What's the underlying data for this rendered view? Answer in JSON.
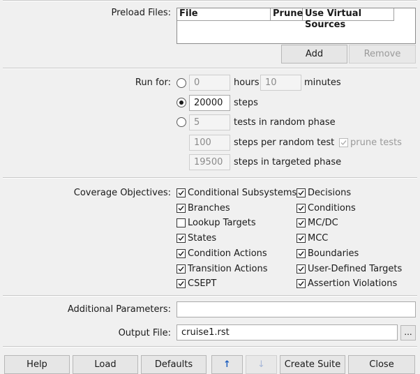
{
  "preload": {
    "label": "Preload Files:",
    "columns": [
      "File",
      "Prune",
      "Use Virtual Sources"
    ],
    "add_label": "Add",
    "remove_label": "Remove"
  },
  "run_for": {
    "label": "Run for:",
    "hours_value": "0",
    "hours_label": "hours",
    "minutes_value": "10",
    "minutes_label": "minutes",
    "steps_value": "20000",
    "steps_label": "steps",
    "tests_value": "5",
    "tests_label": "tests in random phase",
    "steps_per_random_value": "100",
    "steps_per_random_label": "steps per random test",
    "prune_tests_label": "prune tests",
    "steps_targeted_value": "19500",
    "steps_targeted_label": "steps in targeted phase",
    "selected": "steps"
  },
  "coverage": {
    "label": "Coverage Objectives:",
    "left": [
      {
        "label": "Conditional Subsystems",
        "checked": true
      },
      {
        "label": "Branches",
        "checked": true
      },
      {
        "label": "Lookup Targets",
        "checked": false
      },
      {
        "label": "States",
        "checked": true
      },
      {
        "label": "Condition Actions",
        "checked": true
      },
      {
        "label": "Transition Actions",
        "checked": true
      },
      {
        "label": "CSEPT",
        "checked": true
      }
    ],
    "right": [
      {
        "label": "Decisions",
        "checked": true
      },
      {
        "label": "Conditions",
        "checked": true
      },
      {
        "label": "MC/DC",
        "checked": true
      },
      {
        "label": "MCC",
        "checked": true
      },
      {
        "label": "Boundaries",
        "checked": true
      },
      {
        "label": "User-Defined Targets",
        "checked": true
      },
      {
        "label": "Assertion Violations",
        "checked": true
      }
    ]
  },
  "additional": {
    "label": "Additional Parameters:",
    "value": ""
  },
  "output": {
    "label": "Output File:",
    "value": "cruise1.rst",
    "browse_label": "..."
  },
  "buttons": {
    "help": "Help",
    "load": "Load",
    "defaults": "Defaults",
    "up_arrow": "↑",
    "down_arrow": "↓",
    "create_suite": "Create Suite",
    "close": "Close"
  },
  "colors": {
    "window_bg": "#f0f0f0",
    "disabled_text": "#9a9a9a",
    "arrow_blue": "#1f5fbf"
  }
}
